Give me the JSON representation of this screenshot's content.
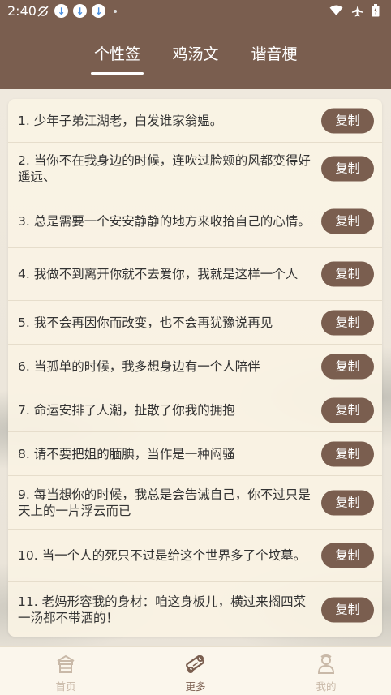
{
  "status_bar": {
    "time": "2:40"
  },
  "tabs": [
    {
      "label": "个性签",
      "active": true
    },
    {
      "label": "鸡汤文",
      "active": false
    },
    {
      "label": "谐音梗",
      "active": false
    }
  ],
  "list": [
    {
      "text": "1. 少年子弟江湖老，白发谁家翁媪。",
      "button": "复制"
    },
    {
      "text": "2. 当你不在我身边的时候，连吹过脸颊的风都变得好遥远、",
      "button": "复制"
    },
    {
      "text": "3. 总是需要一个安安静静的地方来收拾自己的心情。",
      "button": "复制"
    },
    {
      "text": "4. 我做不到离开你就不去爱你，我就是这样一个人",
      "button": "复制"
    },
    {
      "text": "5. 我不会再因你而改变，也不会再犹豫说再见",
      "button": "复制"
    },
    {
      "text": "6. 当孤单的时候，我多想身边有一个人陪伴",
      "button": "复制"
    },
    {
      "text": "7. 命运安排了人潮，扯散了你我的拥抱",
      "button": "复制"
    },
    {
      "text": "8. 请不要把姐的腼腆，当作是一种闷骚",
      "button": "复制"
    },
    {
      "text": "9. 每当想你的时候，我总是会告诫自己，你不过只是天上的一片浮云而已",
      "button": "复制"
    },
    {
      "text": "10. 当一个人的死只不过是给这个世界多了个坟墓。",
      "button": "复制"
    },
    {
      "text": "11. 老妈形容我的身材：咱这身板儿，横过来搁四菜一汤都不带洒的！",
      "button": "复制"
    }
  ],
  "bottom_nav": [
    {
      "label": "首页",
      "icon": "home-icon",
      "active": false
    },
    {
      "label": "更多",
      "icon": "scroll-icon",
      "active": true
    },
    {
      "label": "我的",
      "icon": "profile-icon",
      "active": false
    }
  ],
  "colors": {
    "primary": "#7a5e4f",
    "inactive": "#c9b9a8",
    "card_bg": "#faf3e4"
  }
}
